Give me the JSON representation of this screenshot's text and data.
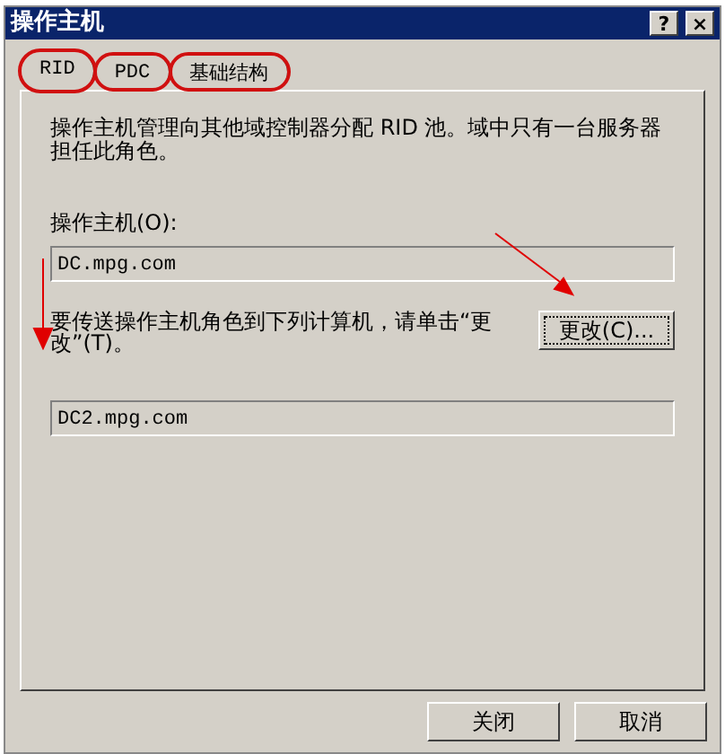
{
  "window": {
    "title": "操作主机",
    "buttons": [
      "?",
      "×"
    ]
  },
  "tabs": [
    {
      "label": "RID",
      "selected": true,
      "circled": true
    },
    {
      "label": "PDC",
      "selected": false,
      "circled": true
    },
    {
      "label": "基础结构",
      "selected": false,
      "circled": true
    }
  ],
  "description": "操作主机管理向其他域控制器分配 RID 池。域中只有一台服务器担任此角色。",
  "master": {
    "label": "操作主机(O):",
    "value": "DC.mpg.com"
  },
  "transfer": {
    "text": "要传送操作主机角色到下列计算机，请单击“更改”(T)。",
    "button": "更改(C)...",
    "value": "DC2.mpg.com"
  },
  "buttons": [
    "关闭",
    "取消"
  ]
}
